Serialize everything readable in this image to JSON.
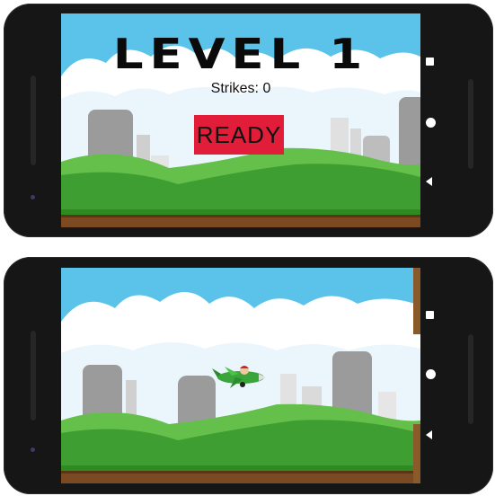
{
  "game": {
    "level_title": "LEVEL 1",
    "strikes_text": "Strikes: 0",
    "ready_label": "READY"
  },
  "icons": {
    "nav_recents": "square-icon",
    "nav_home": "circle-icon",
    "nav_back": "triangle-back-icon",
    "player": "plane-icon"
  },
  "colors": {
    "sky": "#5bc3ea",
    "hills": "#4caf3a",
    "ground": "#7b4a22",
    "ready_button": "#e11d3a"
  }
}
